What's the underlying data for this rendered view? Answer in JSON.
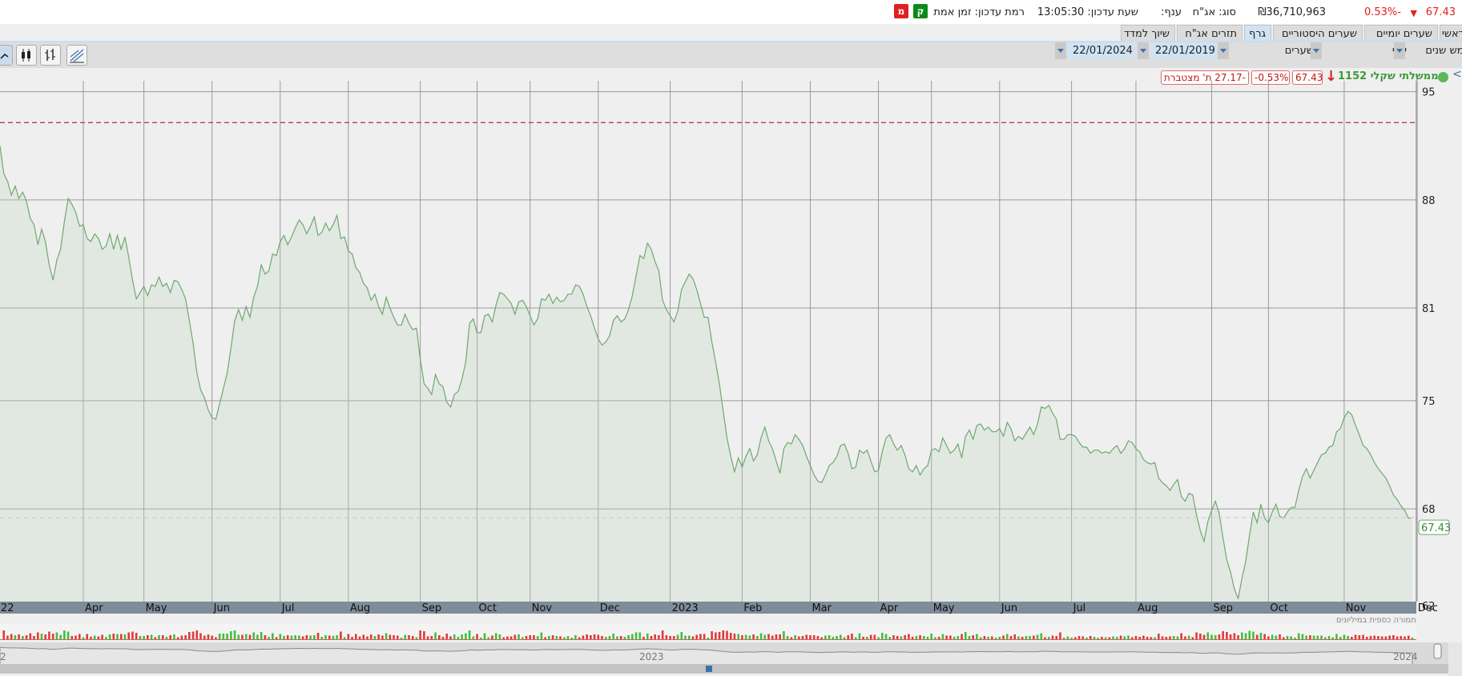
{
  "header": {
    "price": "67.43",
    "change_pct": "-0.53%",
    "turnover": "₪36,710,963",
    "type": "סוג: אג\"ח",
    "branch": "ענף:",
    "update_time": "שעת עדכון: 13:05:30",
    "update_level": "רמת עדכון: זמן אמת",
    "badge_k": "ק",
    "badge_m": "מ",
    "colors": {
      "up": "#0b8a18",
      "down": "#e02020"
    }
  },
  "tabs": [
    "ראשי",
    "שערים יומיים",
    "שערים היסטוריים",
    "גרף",
    "תזרים אג\"ח",
    "שיוך למדד"
  ],
  "active_tab": "גרף",
  "toolbar": {
    "period": "חמש שנים",
    "frequency": "יומי",
    "data_type": "שערים",
    "from_date": "22/01/2019",
    "to_date": "22/01/2024"
  },
  "legend": {
    "security_name": "ממשלתי שקלי 1152",
    "price": "67.43",
    "change_pct": "-0.53%",
    "cumulative": "-27.17 ת' מצטברת"
  },
  "volume_label": "תמורה כספית במיליונים",
  "navigator": {
    "label_2023": "2023",
    "label_2024": "2024",
    "left_stub": "2"
  },
  "chart_data": {
    "type": "area",
    "y_ticks": [
      62,
      68,
      75,
      81,
      88,
      95
    ],
    "ylim": [
      62,
      95.5
    ],
    "reference_line": 93,
    "last_value_label": "67.43",
    "month_labels": [
      {
        "label": "22",
        "idx": 0
      },
      {
        "label": "Apr",
        "idx": 22
      },
      {
        "label": "May",
        "idx": 38
      },
      {
        "label": "Jun",
        "idx": 56
      },
      {
        "label": "Jul",
        "idx": 74
      },
      {
        "label": "Aug",
        "idx": 92
      },
      {
        "label": "Sep",
        "idx": 111
      },
      {
        "label": "Oct",
        "idx": 126
      },
      {
        "label": "Nov",
        "idx": 140
      },
      {
        "label": "Dec",
        "idx": 158
      },
      {
        "label": "2023",
        "idx": 177
      },
      {
        "label": "Feb",
        "idx": 196
      },
      {
        "label": "Mar",
        "idx": 214
      },
      {
        "label": "Apr",
        "idx": 232
      },
      {
        "label": "May",
        "idx": 246
      },
      {
        "label": "Jun",
        "idx": 264
      },
      {
        "label": "Jul",
        "idx": 283
      },
      {
        "label": "Aug",
        "idx": 300
      },
      {
        "label": "Sep",
        "idx": 320
      },
      {
        "label": "Oct",
        "idx": 335
      },
      {
        "label": "Nov",
        "idx": 355
      },
      {
        "label": "Dec",
        "idx": 374
      },
      {
        "label": "2024",
        "idx": 392
      }
    ],
    "values": [
      91.5,
      89.7,
      89.2,
      88.3,
      88.9,
      88.1,
      88.5,
      87.9,
      86.8,
      86.4,
      85.1,
      86.1,
      85.3,
      83.8,
      82.8,
      84.1,
      84.8,
      86.6,
      88.1,
      87.7,
      87.2,
      86.3,
      86.4,
      85.5,
      85.3,
      85.8,
      85.5,
      84.8,
      85.0,
      85.8,
      84.8,
      85.7,
      84.8,
      85.6,
      84.3,
      82.8,
      81.6,
      82.0,
      82.4,
      81.8,
      82.5,
      82.4,
      83.0,
      82.4,
      82.6,
      82.0,
      82.8,
      82.7,
      82.2,
      81.6,
      80.2,
      78.7,
      76.8,
      75.7,
      75.2,
      74.4,
      73.9,
      73.8,
      74.8,
      75.8,
      76.8,
      78.4,
      80.2,
      80.9,
      80.2,
      81.1,
      80.4,
      81.7,
      82.4,
      83.8,
      83.2,
      83.4,
      84.5,
      84.4,
      85.3,
      85.7,
      85.1,
      85.6,
      86.2,
      86.7,
      86.4,
      85.8,
      86.3,
      86.9,
      85.7,
      85.9,
      86.5,
      86.0,
      86.4,
      87.0,
      85.5,
      85.6,
      84.7,
      84.5,
      83.6,
      83.3,
      82.6,
      82.3,
      81.5,
      81.9,
      81.1,
      80.6,
      81.7,
      81.0,
      80.4,
      79.9,
      79.9,
      80.6,
      80.0,
      79.6,
      79.7,
      77.7,
      76.1,
      75.8,
      75.4,
      76.7,
      76.1,
      75.9,
      74.9,
      74.6,
      75.4,
      75.6,
      76.4,
      77.5,
      80.0,
      80.3,
      79.4,
      79.4,
      80.5,
      80.6,
      80.1,
      81.2,
      82.0,
      81.9,
      81.6,
      81.3,
      80.6,
      81.4,
      81.5,
      81.1,
      80.5,
      79.9,
      80.3,
      81.6,
      81.5,
      81.9,
      81.3,
      81.7,
      81.4,
      81.5,
      81.9,
      81.9,
      82.5,
      82.4,
      81.9,
      81.1,
      80.5,
      79.7,
      79.0,
      78.6,
      78.8,
      79.2,
      80.2,
      80.5,
      80.1,
      80.3,
      80.9,
      81.8,
      83.1,
      84.4,
      84.2,
      85.2,
      84.8,
      84.0,
      83.4,
      81.5,
      80.9,
      80.5,
      80.1,
      80.8,
      82.2,
      82.7,
      83.2,
      82.9,
      82.2,
      81.3,
      80.4,
      80.4,
      78.8,
      77.5,
      76.1,
      74.3,
      72.6,
      71.4,
      70.4,
      71.3,
      70.7,
      71.4,
      71.9,
      71.1,
      71.5,
      72.6,
      73.3,
      72.4,
      71.9,
      71.1,
      70.3,
      71.9,
      72.3,
      72.2,
      72.8,
      72.5,
      72.1,
      71.4,
      70.8,
      70.2,
      69.8,
      69.7,
      70.2,
      70.8,
      71.0,
      71.4,
      72.1,
      72.2,
      71.6,
      70.6,
      70.7,
      71.8,
      71.6,
      71.8,
      71.1,
      70.4,
      70.5,
      71.7,
      72.6,
      72.8,
      72.2,
      71.8,
      72.1,
      71.5,
      70.6,
      70.4,
      70.8,
      70.2,
      70.6,
      70.8,
      71.8,
      71.9,
      71.7,
      72.6,
      72.1,
      71.6,
      71.8,
      72.2,
      71.3,
      72.7,
      73.1,
      72.5,
      73.4,
      73.5,
      73.1,
      73.3,
      73.0,
      73.0,
      73.2,
      72.7,
      73.6,
      73.2,
      72.4,
      72.7,
      72.5,
      72.9,
      73.3,
      72.8,
      73.5,
      74.6,
      74.5,
      74.7,
      74.2,
      73.8,
      72.5,
      72.5,
      72.8,
      72.8,
      72.7,
      72.3,
      72.0,
      72.0,
      71.6,
      71.8,
      71.8,
      71.6,
      71.7,
      71.6,
      71.9,
      72.1,
      71.6,
      71.9,
      72.4,
      72.3,
      71.9,
      71.7,
      71.2,
      71.0,
      70.9,
      71.0,
      70.0,
      69.7,
      69.5,
      69.2,
      69.6,
      69.9,
      68.8,
      68.5,
      69.0,
      68.9,
      67.6,
      66.6,
      65.9,
      67.2,
      67.9,
      68.5,
      67.7,
      66.1,
      64.7,
      63.9,
      62.8,
      62.2,
      63.5,
      64.6,
      66.3,
      67.8,
      67.1,
      68.3,
      67.4,
      67.1,
      67.8,
      68.3,
      67.5,
      67.4,
      67.8,
      68.1,
      68.1,
      69.2,
      70.1,
      70.6,
      70.0,
      70.5,
      71.0,
      71.5,
      71.6,
      72.0,
      72.1,
      73.0,
      73.2,
      73.9,
      74.3,
      74.1,
      73.4,
      72.8,
      72.1,
      71.9,
      71.5,
      71.0,
      70.6,
      70.3,
      70.0,
      69.5,
      68.9,
      68.6,
      68.2,
      67.9,
      67.4,
      67.43
    ]
  }
}
